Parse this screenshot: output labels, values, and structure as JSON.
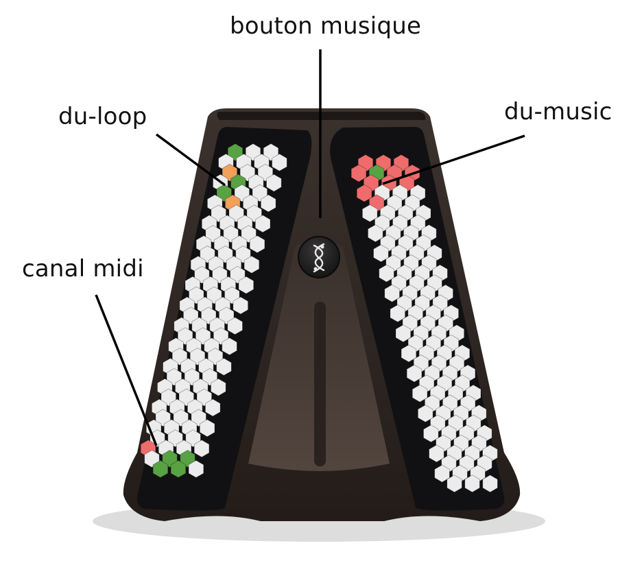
{
  "callouts": {
    "bouton_musique": "bouton musique",
    "du_loop": "du-loop",
    "du_music": "du-music",
    "canal_midi": "canal midi"
  },
  "colors": {
    "background": "#ffffff",
    "body_dark": "#2e2622",
    "body_highlight": "#5a4c44",
    "panel": "#111114",
    "key_white": "#ececec",
    "key_green": "#58a243",
    "key_orange": "#f2a05a",
    "key_red": "#ef6c6c",
    "leader_line": "#000000"
  },
  "icons": {
    "center_button": "music-dna-logo-icon"
  },
  "keyboards": {
    "left": {
      "green_keys": 7,
      "orange_keys": 2,
      "red_keys": 1
    },
    "right": {
      "green_keys": 1,
      "red_keys": 11
    }
  }
}
